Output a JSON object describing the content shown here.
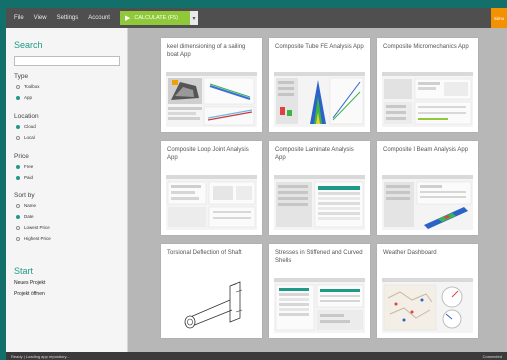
{
  "menubar": {
    "menus": [
      "File",
      "View",
      "Settings",
      "Account"
    ],
    "calculate_label": "CALCULATE (F5)",
    "dropdown_glyph": "▾",
    "orange_label": "Simu"
  },
  "sidebar": {
    "search": {
      "heading": "Search",
      "value": ""
    },
    "type": {
      "heading": "Type",
      "options": [
        "Toolbox",
        "App"
      ],
      "selected": "App"
    },
    "location": {
      "heading": "Location",
      "options": [
        "Cloud",
        "Local"
      ],
      "selected": "Cloud"
    },
    "price": {
      "heading": "Price",
      "options": [
        "Free",
        "Paid"
      ],
      "selected": [
        "Free",
        "Paid"
      ]
    },
    "sort": {
      "heading": "Sort by",
      "options": [
        "Name",
        "Date",
        "Lowest Price",
        "Highest Price"
      ],
      "selected": "Date"
    },
    "start": {
      "heading": "Start",
      "links": [
        "Neues Projekt",
        "Projekt öffnen"
      ]
    }
  },
  "cards": [
    {
      "title": "keel dimensioning of a sailing boat App",
      "thumb": "boat-3d"
    },
    {
      "title": "Composite Tube FE Analysis App",
      "thumb": "tube-fe"
    },
    {
      "title": "Composite Micromechanics App",
      "thumb": "form-grey"
    },
    {
      "title": "Composite Loop Joint Analysis App",
      "thumb": "form-grey"
    },
    {
      "title": "Composite Laminate Analysis App",
      "thumb": "table-green"
    },
    {
      "title": "Composite I Beam Analysis App",
      "thumb": "beam-fe"
    },
    {
      "title": "Torsional Deflection of Shaft",
      "thumb": "shaft-drawing"
    },
    {
      "title": "Stresses in Stiffened and Curved Shells",
      "thumb": "form-green"
    },
    {
      "title": "Weather Dashboard",
      "thumb": "map-gauges"
    }
  ],
  "status": {
    "left_text": "Ready | Loading app repository...",
    "right_text": "Connected"
  },
  "colors": {
    "accent": "#1f9a86",
    "calculate": "#8fc93a",
    "orange": "#f39200",
    "background": "#126f6a"
  }
}
